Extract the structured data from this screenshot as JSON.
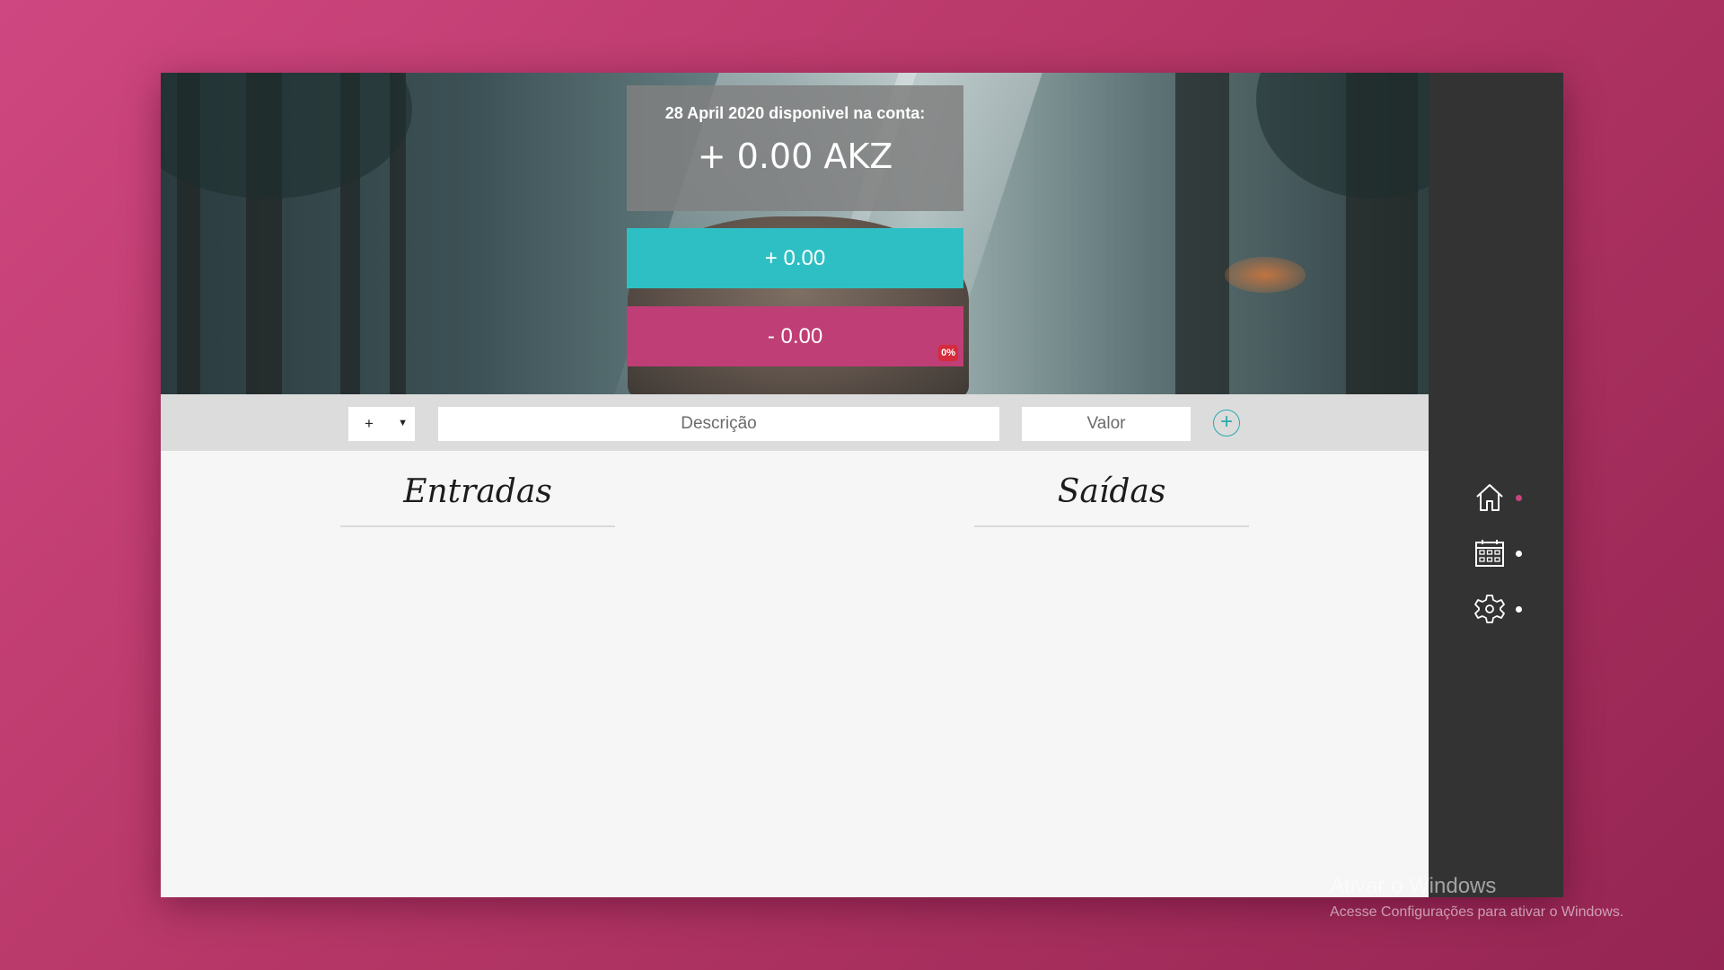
{
  "balance": {
    "title": "28 April 2020 disponivel na conta:",
    "amount": "+ 0.00 AKZ"
  },
  "income": {
    "label": "+ 0.00"
  },
  "expense": {
    "label": "- 0.00",
    "percent_badge": "0%"
  },
  "form": {
    "type_value": "+",
    "description_placeholder": "Descrição",
    "value_placeholder": "Valor",
    "add_symbol": "+"
  },
  "columns": {
    "income_title": "Entradas",
    "expense_title": "Saídas"
  },
  "sidebar": {
    "items": [
      {
        "icon": "home-icon",
        "active": true
      },
      {
        "icon": "calendar-icon",
        "active": false
      },
      {
        "icon": "gear-icon",
        "active": false
      }
    ]
  },
  "watermark": {
    "title": "Ativar o Windows",
    "subtitle": "Acesse Configurações para ativar o Windows."
  },
  "colors": {
    "income": "#2ebfc4",
    "expense": "#bf3e76",
    "sidebar": "#333333",
    "accent_dot": "#c8457d",
    "badge": "#d62b3c"
  }
}
